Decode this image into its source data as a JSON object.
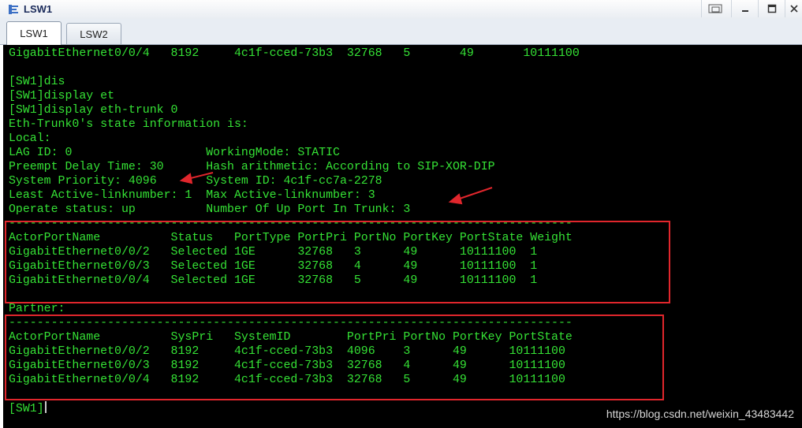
{
  "window": {
    "title": "LSW1",
    "icon": "network-switch-icon",
    "controls": [
      "restore-icon",
      "minimize-icon",
      "maximize-icon",
      "close-icon"
    ]
  },
  "tabs": [
    {
      "label": "LSW1",
      "active": true
    },
    {
      "label": "LSW2",
      "active": false
    }
  ],
  "terminal": {
    "lines": [
      "GigabitEthernet0/0/4   8192     4c1f-cced-73b3  32768   5       49       10111100",
      "",
      "[SW1]dis",
      "[SW1]display et",
      "[SW1]display eth-trunk 0",
      "Eth-Trunk0's state information is:",
      "Local:",
      "LAG ID: 0                   WorkingMode: STATIC",
      "Preempt Delay Time: 30      Hash arithmetic: According to SIP-XOR-DIP",
      "System Priority: 4096       System ID: 4c1f-cc7a-2278",
      "Least Active-linknumber: 1  Max Active-linknumber: 3",
      "Operate status: up          Number Of Up Port In Trunk: 3",
      "--------------------------------------------------------------------------------",
      "ActorPortName          Status   PortType PortPri PortNo PortKey PortState Weight",
      "GigabitEthernet0/0/2   Selected 1GE      32768   3      49      10111100  1",
      "GigabitEthernet0/0/3   Selected 1GE      32768   4      49      10111100  1",
      "GigabitEthernet0/0/4   Selected 1GE      32768   5      49      10111100  1",
      "",
      "Partner:",
      "--------------------------------------------------------------------------------",
      "ActorPortName          SysPri   SystemID        PortPri PortNo PortKey PortState",
      "GigabitEthernet0/0/2   8192     4c1f-cced-73b3  4096    3      49      10111100",
      "GigabitEthernet0/0/3   8192     4c1f-cced-73b3  32768   4      49      10111100",
      "GigabitEthernet0/0/4   8192     4c1f-cced-73b3  32768   5      49      10111100",
      ""
    ],
    "prompt": "[SW1]"
  },
  "watermark": "https://blog.csdn.net/weixin_43483442",
  "colors": {
    "terminal_bg": "#000000",
    "terminal_text": "#35e235",
    "highlight_box": "#e0262c"
  }
}
